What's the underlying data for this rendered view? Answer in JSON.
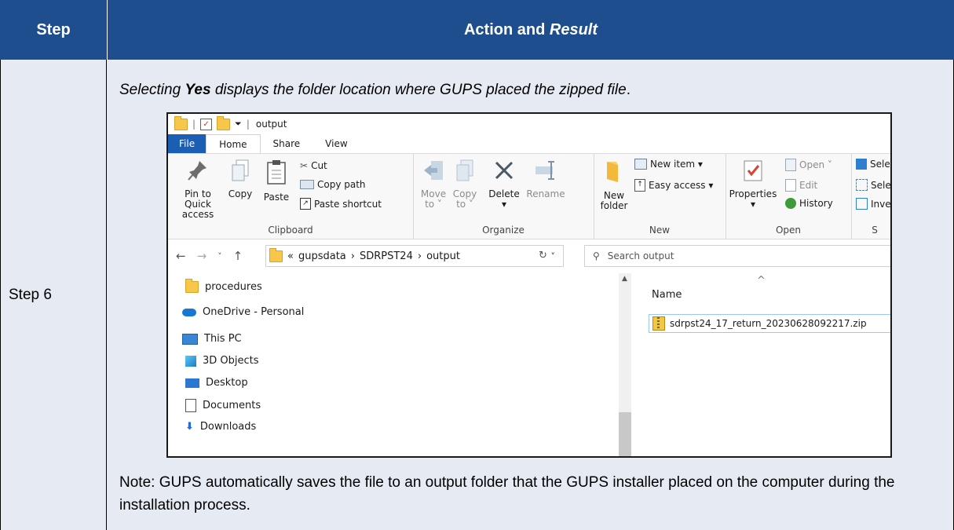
{
  "table": {
    "header_step": "Step",
    "header_action": "Action and ",
    "header_action_italic": "Result",
    "step_label": "Step 6",
    "intro_before": "Selecting ",
    "intro_bold": "Yes",
    "intro_after": " displays the folder location where GUPS placed the zipped file",
    "intro_end": ".",
    "note": "Note: GUPS automatically saves the file to an output folder that the GUPS installer placed on the computer during the installation process."
  },
  "explorer": {
    "title": "output",
    "tabs": [
      "File",
      "Home",
      "Share",
      "View"
    ],
    "clipboard": {
      "pin_line1": "Pin to Quick",
      "pin_line2": "access",
      "copy": "Copy",
      "paste": "Paste",
      "cut": "Cut",
      "copy_path": "Copy path",
      "paste_shortcut": "Paste shortcut",
      "label": "Clipboard"
    },
    "organize": {
      "move_to": "Move",
      "move_to2": "to ˅",
      "copy_to": "Copy",
      "copy_to2": "to ˅",
      "delete": "Delete",
      "delete_caret": "▾",
      "rename": "Rename",
      "label": "Organize"
    },
    "new": {
      "new_folder1": "New",
      "new_folder2": "folder",
      "new_item": "New item ▾",
      "easy_access": "Easy access ▾",
      "label": "New"
    },
    "open": {
      "properties": "Properties",
      "properties_caret": "▾",
      "open": "Open ˅",
      "edit": "Edit",
      "history": "History",
      "label": "Open"
    },
    "select": {
      "select_all": "Sele",
      "select_none": "Sele",
      "invert": "Inve",
      "label": "S"
    },
    "address": {
      "prefix": "«",
      "part1": "gupsdata",
      "part2": "SDRPST24",
      "part3": "output",
      "chevron": "›"
    },
    "search_placeholder": "Search output",
    "nav_items": [
      "procedures",
      "OneDrive - Personal",
      "This PC",
      "3D Objects",
      "Desktop",
      "Documents",
      "Downloads"
    ],
    "column_name": "Name",
    "file_name": "sdrpst24_17_return_20230628092217.zip"
  }
}
